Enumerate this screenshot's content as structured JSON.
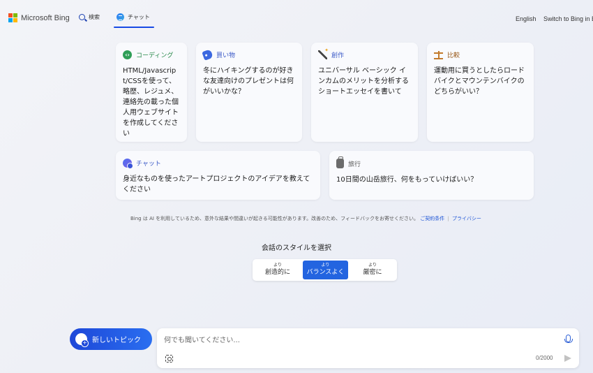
{
  "header": {
    "brand": "Microsoft Bing",
    "tabs": [
      {
        "label": "検索"
      },
      {
        "label": "チャット"
      }
    ],
    "language": "English",
    "switch_text": "Switch to Bing in E"
  },
  "cards": [
    {
      "category": "コーディング",
      "icon": "code-icon",
      "text": "HTML/Javascript/CSSを使って、略歴、レジュメ、連絡先の載った個人用ウェブサイトを作成してください"
    },
    {
      "category": "買い物",
      "icon": "tag-icon",
      "text": "冬にハイキングするのが好きな友達向けのプレゼントは何がいいかな？"
    },
    {
      "category": "創作",
      "icon": "magic-wand-icon",
      "text": "ユニバーサル ベーシック インカムのメリットを分析するショートエッセイを書いて"
    },
    {
      "category": "比較",
      "icon": "scale-icon",
      "text": "運動用に買うとしたらロードバイクとマウンテンバイクのどちらがいい？"
    },
    {
      "category": "チャット",
      "icon": "chat-bubble-icon",
      "text": "身近なものを使ったアートプロジェクトのアイデアを教えてください"
    },
    {
      "category": "旅行",
      "icon": "luggage-icon",
      "text": "10日間の山岳旅行、何をもっていけばいい？"
    }
  ],
  "disclaimer": {
    "text": "Bing は AI を利用しているため、意外な結果や間違いが起きる可能性があります。改善のため、フィードバックをお寄せください。",
    "terms_link": "ご契約条件",
    "privacy_link": "プライバシー"
  },
  "style_selector": {
    "title": "会話のスタイルを選択",
    "options": [
      {
        "small": "より",
        "label": "創造的に"
      },
      {
        "small": "より",
        "label": "バランスよく"
      },
      {
        "small": "より",
        "label": "厳密に"
      }
    ],
    "selected_index": 1
  },
  "new_topic": {
    "label": "新しいトピック"
  },
  "input": {
    "placeholder": "何でも聞いてください...",
    "value": "",
    "char_count": "0/2000"
  },
  "colors": {
    "accent": "#2364e0",
    "new_topic_start": "#1d47d8",
    "new_topic_end": "#2a6ef0",
    "link": "#1f55d6"
  }
}
